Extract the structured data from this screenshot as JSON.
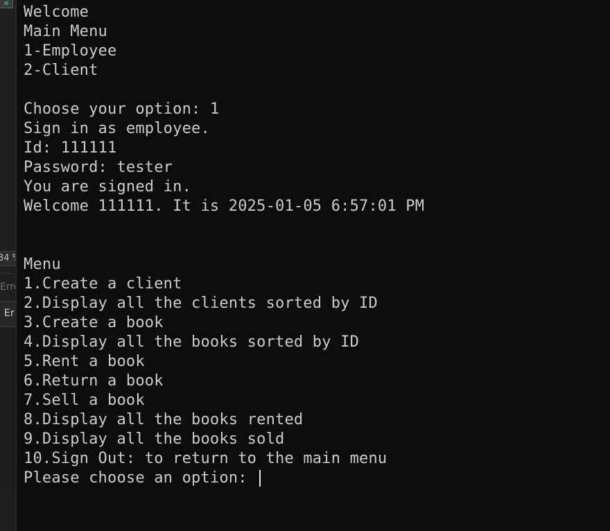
{
  "background_ide": {
    "zoom_fragment": "34 %",
    "error_fragment_1": "Erro",
    "error_fragment_2": "Er"
  },
  "console": {
    "lines": [
      "Welcome",
      "Main Menu",
      "1-Employee",
      "2-Client",
      "",
      "Choose your option: 1",
      "Sign in as employee.",
      "Id: 111111",
      "Password: tester",
      "You are signed in.",
      "Welcome 111111. It is 2025-01-05 6:57:01 PM",
      "",
      "",
      "Menu",
      "1.Create a client",
      "2.Display all the clients sorted by ID",
      "3.Create a book",
      "4.Display all the books sorted by ID",
      "5.Rent a book",
      "6.Return a book",
      "7.Sell a book",
      "8.Display all the books rented",
      "9.Display all the books sold",
      "10.Sign Out: to return to the main menu"
    ],
    "prompt": "Please choose an option: "
  },
  "colors": {
    "console_bg": "#0c0c0c",
    "console_text": "#cccccc",
    "ide_bg": "#1f1f1f"
  }
}
